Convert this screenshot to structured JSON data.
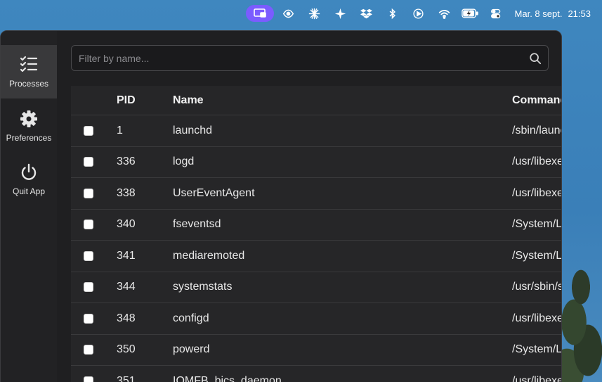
{
  "menubar": {
    "icons": [
      "display-mirror-icon",
      "eye-icon",
      "snowflake-burst-icon",
      "sparkle-icon",
      "dropbox-icon",
      "bluetooth-icon",
      "play-circle-icon",
      "wifi-icon",
      "battery-charging-icon",
      "control-center-icon"
    ],
    "date": "Mar. 8 sept.",
    "time": "21:53",
    "active_color": "#7b5cff"
  },
  "sidebar": {
    "items": [
      {
        "label": "Processes",
        "icon": "checklist-icon",
        "active": true
      },
      {
        "label": "Preferences",
        "icon": "gear-icon",
        "active": false
      },
      {
        "label": "Quit App",
        "icon": "power-icon",
        "active": false
      }
    ]
  },
  "search": {
    "placeholder": "Filter by name...",
    "value": ""
  },
  "table": {
    "columns": [
      "PID",
      "Name",
      "Command"
    ],
    "rows": [
      {
        "pid": "1",
        "name": "launchd",
        "command": "/sbin/launchd"
      },
      {
        "pid": "336",
        "name": "logd",
        "command": "/usr/libexec/logd"
      },
      {
        "pid": "338",
        "name": "UserEventAgent",
        "command": "/usr/libexec/UserEventAgent"
      },
      {
        "pid": "340",
        "name": "fseventsd",
        "command": "/System/Library"
      },
      {
        "pid": "341",
        "name": "mediaremoted",
        "command": "/System/Library"
      },
      {
        "pid": "344",
        "name": "systemstats",
        "command": "/usr/sbin/systemstats"
      },
      {
        "pid": "348",
        "name": "configd",
        "command": "/usr/libexec/configd"
      },
      {
        "pid": "350",
        "name": "powerd",
        "command": "/System/Library"
      },
      {
        "pid": "351",
        "name": "IOMFB_bics_daemon",
        "command": "/usr/libexec"
      }
    ]
  }
}
